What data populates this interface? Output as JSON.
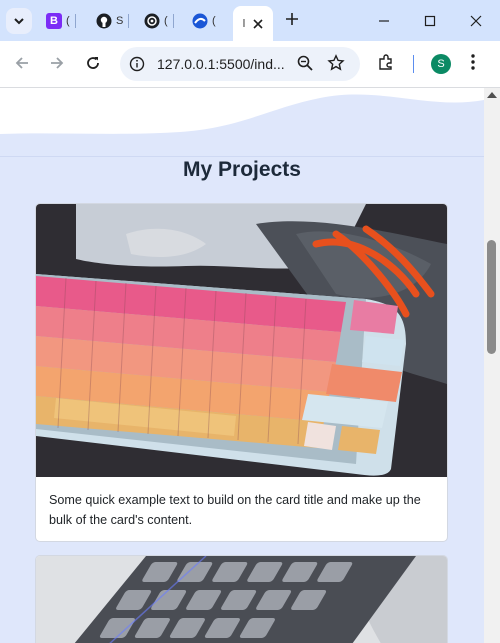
{
  "tabs": [
    {
      "icon": "bootstrap-icon",
      "letter": "B",
      "title": "(",
      "color": "#7b2cf6"
    },
    {
      "icon": "github-icon",
      "letter": "",
      "title": "S",
      "color": "#1b1f24"
    },
    {
      "icon": "chatgpt-icon",
      "letter": "",
      "title": "(",
      "color": "#1b1f24"
    },
    {
      "icon": "edge-swirl-icon",
      "letter": "",
      "title": "(",
      "color": "#1a56d6"
    }
  ],
  "active_tab": {
    "title": "l",
    "close_icon": "close-icon"
  },
  "toolbar": {
    "url": "127.0.0.1:5500/ind...",
    "profile_initial": "S"
  },
  "page": {
    "section_title": "My Projects",
    "card1_text": "Some quick example text to build on the card title and make up the bulk of the card's content.",
    "card1_image_alt": "keyboard-photo",
    "card2_image_alt": "keyboard-photo"
  },
  "colors": {
    "tabstrip": "#d3e3fd",
    "page_bg": "#dfe7fb",
    "profile": "#0b8a64"
  }
}
